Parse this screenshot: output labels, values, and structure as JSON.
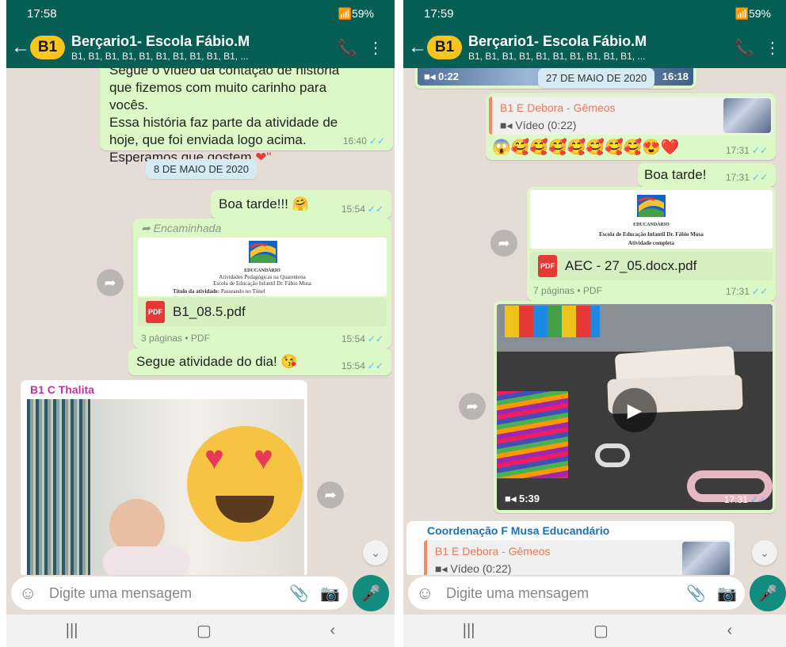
{
  "left": {
    "status": {
      "time": "17:58",
      "battery": "59%"
    },
    "header": {
      "avatar": "B1",
      "title": "Berçario1- Escola Fábio.M",
      "subtitle": "B1, B1, B1, B1, B1, B1, B1, B1, B1, B1, ..."
    },
    "messages": {
      "story_lines": [
        "Segue o vídeo da contação de história",
        "que fizemos com muito carinho para",
        "vocês.",
        "Essa história faz parte da atividade de",
        "hoje, que foi enviada logo acima.",
        "Esperamos que gostem"
      ],
      "story_end": " ❤\"",
      "story_time": "16:40",
      "date_pill": "8 DE MAIO DE 2020",
      "boa_tarde": "Boa tarde!!! 🤗",
      "boa_tarde_time": "15:54",
      "forwarded_label": "Encaminhada",
      "doc_line1": "Atividades Pedagógicas na Quarentena",
      "doc_line2": "Escola de Educação Infantil Dr. Fábio Musa",
      "doc_title_label": "Título da atividade:",
      "doc_title_value": "Passeando no Túnel",
      "doc_brand": "EDUCANDÁRIO",
      "doc_name": "B1_08.5.pdf",
      "doc_pages": "3 páginas • PDF",
      "doc_time": "15:54",
      "atividade": "Segue atividade do dia! 😘",
      "atividade_time": "15:54",
      "sender": "B1 C Thalita"
    },
    "composer": {
      "placeholder": "Digite uma mensagem"
    }
  },
  "right": {
    "status": {
      "time": "17:59",
      "battery": "59%"
    },
    "header": {
      "avatar": "B1",
      "title": "Berçario1- Escola Fábio.M",
      "subtitle": "B1, B1, B1, B1, B1, B1, B1, B1, B1, B1, ..."
    },
    "messages": {
      "video_duration_top": "0:22",
      "date_pill": "27 DE MAIO DE 2020",
      "video_time_top": "16:18",
      "quote_name": "B1 E Debora - Gêmeos",
      "quote_sub": "Vídeo (0:22)",
      "emojis": "😱🥰🥰🥰🥰🥰🥰🥰😍❤️",
      "emojis_time": "17:31",
      "boa_tarde": "Boa tarde!",
      "boa_tarde_time": "17:31",
      "doc_brand": "EDUCANDÁRIO",
      "doc_line1": "Escola de Educação Infantil Dr. Fábio Musa",
      "doc_line2": "Atividade completa",
      "doc_name": "AEC - 27_05.docx.pdf",
      "doc_pages": "7 páginas • PDF",
      "doc_time": "17:31",
      "video_duration": "5:39",
      "video_time": "17:31",
      "coord_sender": "Coordenação F Musa Educandário",
      "coord_quote_name": "B1 E Debora - Gêmeos",
      "coord_quote_sub": "Vídeo (0:22)"
    },
    "composer": {
      "placeholder": "Digite uma mensagem"
    }
  },
  "colors": {
    "header": "#075e54",
    "outgoing": "#dcf8c6",
    "incoming": "#ffffff",
    "ticks": "#4fc3f7",
    "mic": "#128c7e"
  }
}
